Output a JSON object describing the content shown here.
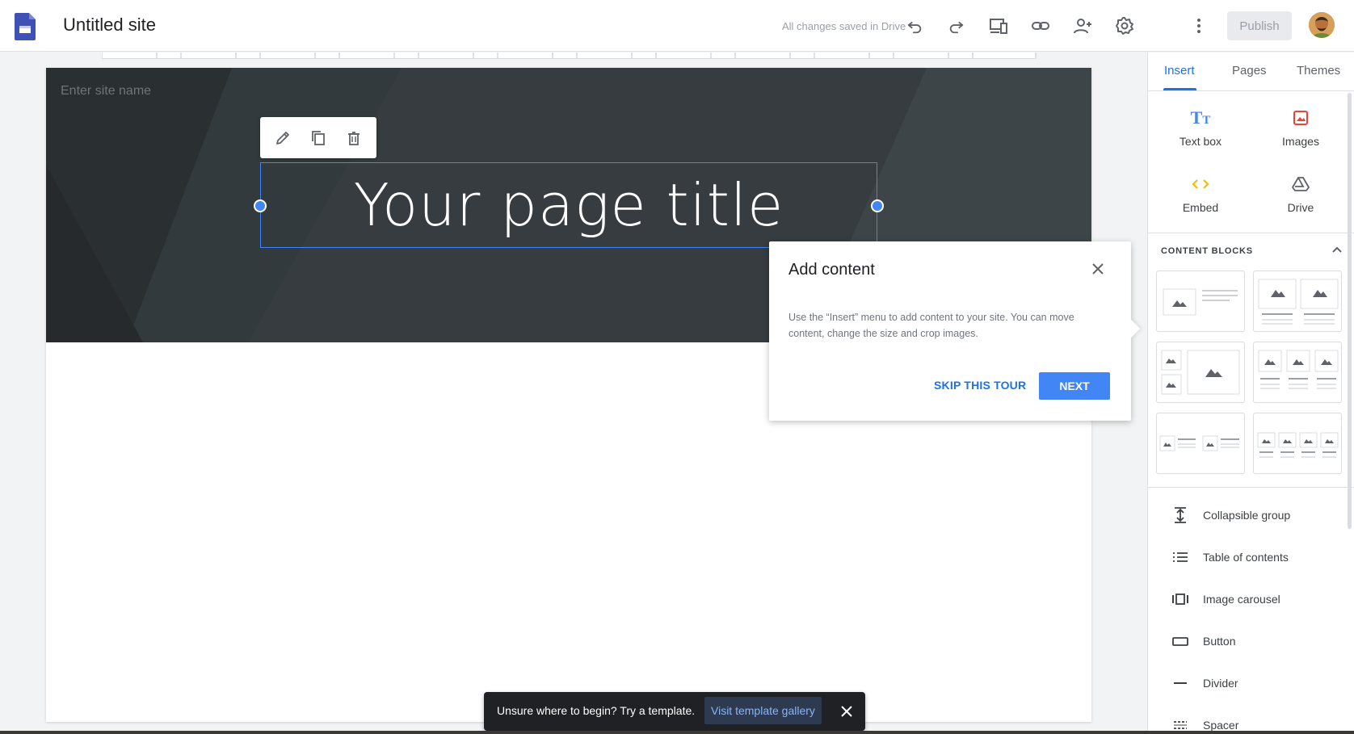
{
  "topbar": {
    "title": "Untitled site",
    "saved_status": "All changes saved in Drive",
    "publish_label": "Publish",
    "icons": [
      "undo-icon",
      "redo-icon",
      "preview-device-icon",
      "link-icon",
      "share-person-icon",
      "settings-gear-icon",
      "more-vert-icon"
    ]
  },
  "canvas": {
    "site_name_placeholder": "Enter site name",
    "page_title": "Your page title",
    "title_toolbar": [
      "edit-pencil-icon",
      "duplicate-icon",
      "delete-icon"
    ]
  },
  "popover": {
    "title": "Add content",
    "body": "Use the “Insert” menu to add content to your site. You can move content, change the size and crop images.",
    "skip_label": "SKIP THIS TOUR",
    "next_label": "NEXT"
  },
  "snackbar": {
    "text": "Unsure where to begin? Try a template.",
    "link_label": "Visit template gallery"
  },
  "panel": {
    "tabs": [
      {
        "label": "Insert",
        "active": true
      },
      {
        "label": "Pages",
        "active": false
      },
      {
        "label": "Themes",
        "active": false
      }
    ],
    "insert_items": [
      {
        "label": "Text box",
        "icon": "text-box-icon"
      },
      {
        "label": "Images",
        "icon": "images-icon"
      },
      {
        "label": "Embed",
        "icon": "embed-code-icon"
      },
      {
        "label": "Drive",
        "icon": "drive-icon"
      }
    ],
    "content_blocks_header": "CONTENT BLOCKS",
    "list_items": [
      {
        "label": "Collapsible group",
        "icon": "collapsible-group-icon"
      },
      {
        "label": "Table of contents",
        "icon": "table-of-contents-icon"
      },
      {
        "label": "Image carousel",
        "icon": "image-carousel-icon"
      },
      {
        "label": "Button",
        "icon": "button-icon"
      },
      {
        "label": "Divider",
        "icon": "divider-icon"
      },
      {
        "label": "Spacer",
        "icon": "spacer-icon"
      }
    ]
  },
  "colors": {
    "accent": "#1a73e8",
    "hero_bg": "#2f3436",
    "selection": "#4285f4"
  }
}
